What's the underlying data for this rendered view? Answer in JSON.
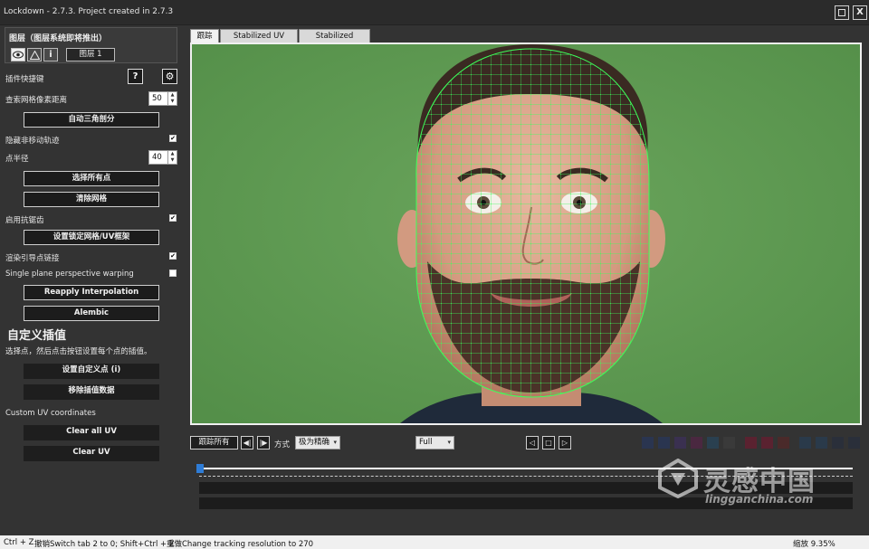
{
  "window": {
    "title": "Lockdown - 2.7.3. Project created in 2.7.3",
    "restore_icon": "restore-icon",
    "close_label": "X"
  },
  "layer": {
    "title": "图层（图层系统即将推出）",
    "eye_icon": "eye-icon",
    "warning_icon": "warning-icon",
    "info_label": "i",
    "layer_button": "图层 1"
  },
  "panel": {
    "plugin_shortcut_label": "插件快捷键",
    "help_label": "?",
    "settings_icon": "gear-icon",
    "search_radius_label": "查索网格像素距离",
    "search_radius_value": "50",
    "auto_triangulate": "自动三角剖分",
    "hide_nonmoving_label": "隐藏非移动轨迹",
    "point_radius_label": "点半径",
    "point_radius_value": "40",
    "select_all_points": "选择所有点",
    "clear_mesh": "清除网格",
    "antialias_label": "启用抗锯齿",
    "set_lock_mesh": "设置锁定网格/UV框架",
    "render_guides_label": "渲染引导点链接",
    "single_plane_label": "Single plane perspective warping",
    "reapply_interpolation": "Reapply Interpolation",
    "alembic": "Alembic",
    "custom_interp_title": "自定义插值",
    "custom_interp_desc": "选择点，然后点击按钮设置每个点的插值。",
    "set_custom_point": "设置自定义点 (i)",
    "remove_interp": "移除插值数据",
    "custom_uv_label": "Custom UV coordinates",
    "clear_all_uv": "Clear all UV",
    "clear_uv": "Clear UV"
  },
  "checkboxes": {
    "hide_nonmoving": true,
    "antialias": true,
    "render_guides": true,
    "single_plane": false
  },
  "tabs": [
    "跟踪",
    "Stabilized UV Layout",
    "Stabilized Tracking"
  ],
  "controls": {
    "track_all": "跟踪所有",
    "prev_label": "◀|",
    "next_label": "|▶",
    "mode_label": "方式",
    "mode_value": "极为精确",
    "resolution_value": "Full",
    "play_prev": "◁",
    "play_stop": "□",
    "play_next": "▷"
  },
  "status": {
    "undo_shortcut": "Ctrl + Z",
    "undo_text": "撤销Switch tab 2 to 0; Shift+Ctrl + Z",
    "redo_text": "重做Change tracking resolution to 270",
    "zoom_text": "缩放 9.35%"
  },
  "watermark": {
    "logo_cn": "灵感中国",
    "logo_en": "lingganchina.com"
  },
  "colors": {
    "green_screen": "#5f9a53",
    "mesh_green": "#39ff56",
    "playhead": "#2e7cd6"
  }
}
